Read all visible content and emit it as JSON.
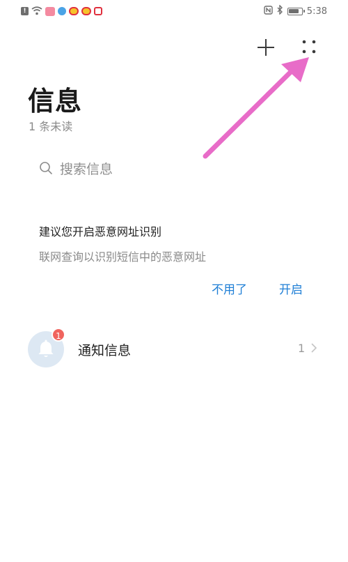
{
  "status_bar": {
    "left_icons": [
      "alert-icon",
      "wifi-icon",
      "app-icon-pink",
      "app-icon-blue",
      "weibo-icon",
      "weibo-icon",
      "app-icon-red-square"
    ],
    "right_icons": [
      "nfc-icon",
      "bluetooth-icon",
      "battery-icon"
    ],
    "time": "5:38",
    "battery_level": 0.85
  },
  "toolbar": {
    "add_icon": "plus-icon",
    "more_icon": "more-grid-icon"
  },
  "header": {
    "title": "信息",
    "unread": "1 条未读"
  },
  "search": {
    "placeholder": "搜索信息"
  },
  "suggestion": {
    "title": "建议您开启恶意网址识别",
    "description": "联网查询以识别短信中的恶意网址",
    "decline_label": "不用了",
    "enable_label": "开启"
  },
  "conversations": [
    {
      "name": "通知信息",
      "badge": "1",
      "count": "1",
      "icon": "bell-icon"
    }
  ],
  "colors": {
    "accent": "#1f7fd6",
    "badge": "#f0645e",
    "annotation": "#e86cc8",
    "avatar_bg": "#dde8f3"
  }
}
